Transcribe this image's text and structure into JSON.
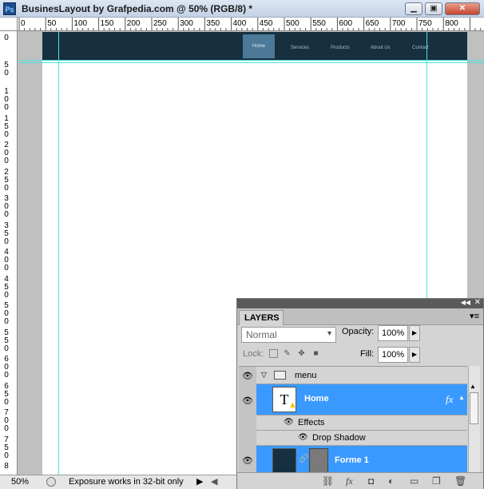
{
  "window": {
    "title": "BusinesLayout by Grafpedia.com @ 50% (RGB/8) *",
    "app_icon": "Ps",
    "buttons": {
      "minimize": "▁",
      "restore": "▣",
      "close": "✕"
    }
  },
  "ruler": {
    "h_labels": [
      "0",
      "50",
      "100",
      "150",
      "200",
      "250",
      "300",
      "350",
      "400",
      "450",
      "500",
      "550",
      "600",
      "650",
      "700",
      "750",
      "800"
    ],
    "v_labels": [
      [
        "0"
      ],
      [
        "5",
        "0"
      ],
      [
        "1",
        "0",
        "0"
      ],
      [
        "1",
        "5",
        "0"
      ],
      [
        "2",
        "0",
        "0"
      ],
      [
        "2",
        "5",
        "0"
      ],
      [
        "3",
        "0",
        "0"
      ],
      [
        "3",
        "5",
        "0"
      ],
      [
        "4",
        "0",
        "0"
      ],
      [
        "4",
        "5",
        "0"
      ],
      [
        "5",
        "0",
        "0"
      ],
      [
        "5",
        "5",
        "0"
      ],
      [
        "6",
        "0",
        "0"
      ],
      [
        "6",
        "5",
        "0"
      ],
      [
        "7",
        "0",
        "0"
      ],
      [
        "7",
        "5",
        "0"
      ],
      [
        "8"
      ]
    ]
  },
  "canvas": {
    "nav": [
      "Home",
      "Services",
      "Products",
      "About Us",
      "Contact"
    ],
    "menubar_color": "#16303f",
    "active_color": "#4d7998",
    "guide_color": "#4fe0e0"
  },
  "status": {
    "zoom": "50%",
    "message": "Exposure works in 32-bit only"
  },
  "layers_panel": {
    "tab": "LAYERS",
    "blend_mode": "Normal",
    "opacity_label": "Opacity:",
    "opacity": "100%",
    "lock_label": "Lock:",
    "fill_label": "Fill:",
    "fill": "100%",
    "layers": {
      "group": "menu",
      "home": "Home",
      "fx": "fx",
      "effects": "Effects",
      "drop_shadow": "Drop Shadow",
      "forme": "Forme 1"
    },
    "selected_color": "#3a99ff"
  }
}
